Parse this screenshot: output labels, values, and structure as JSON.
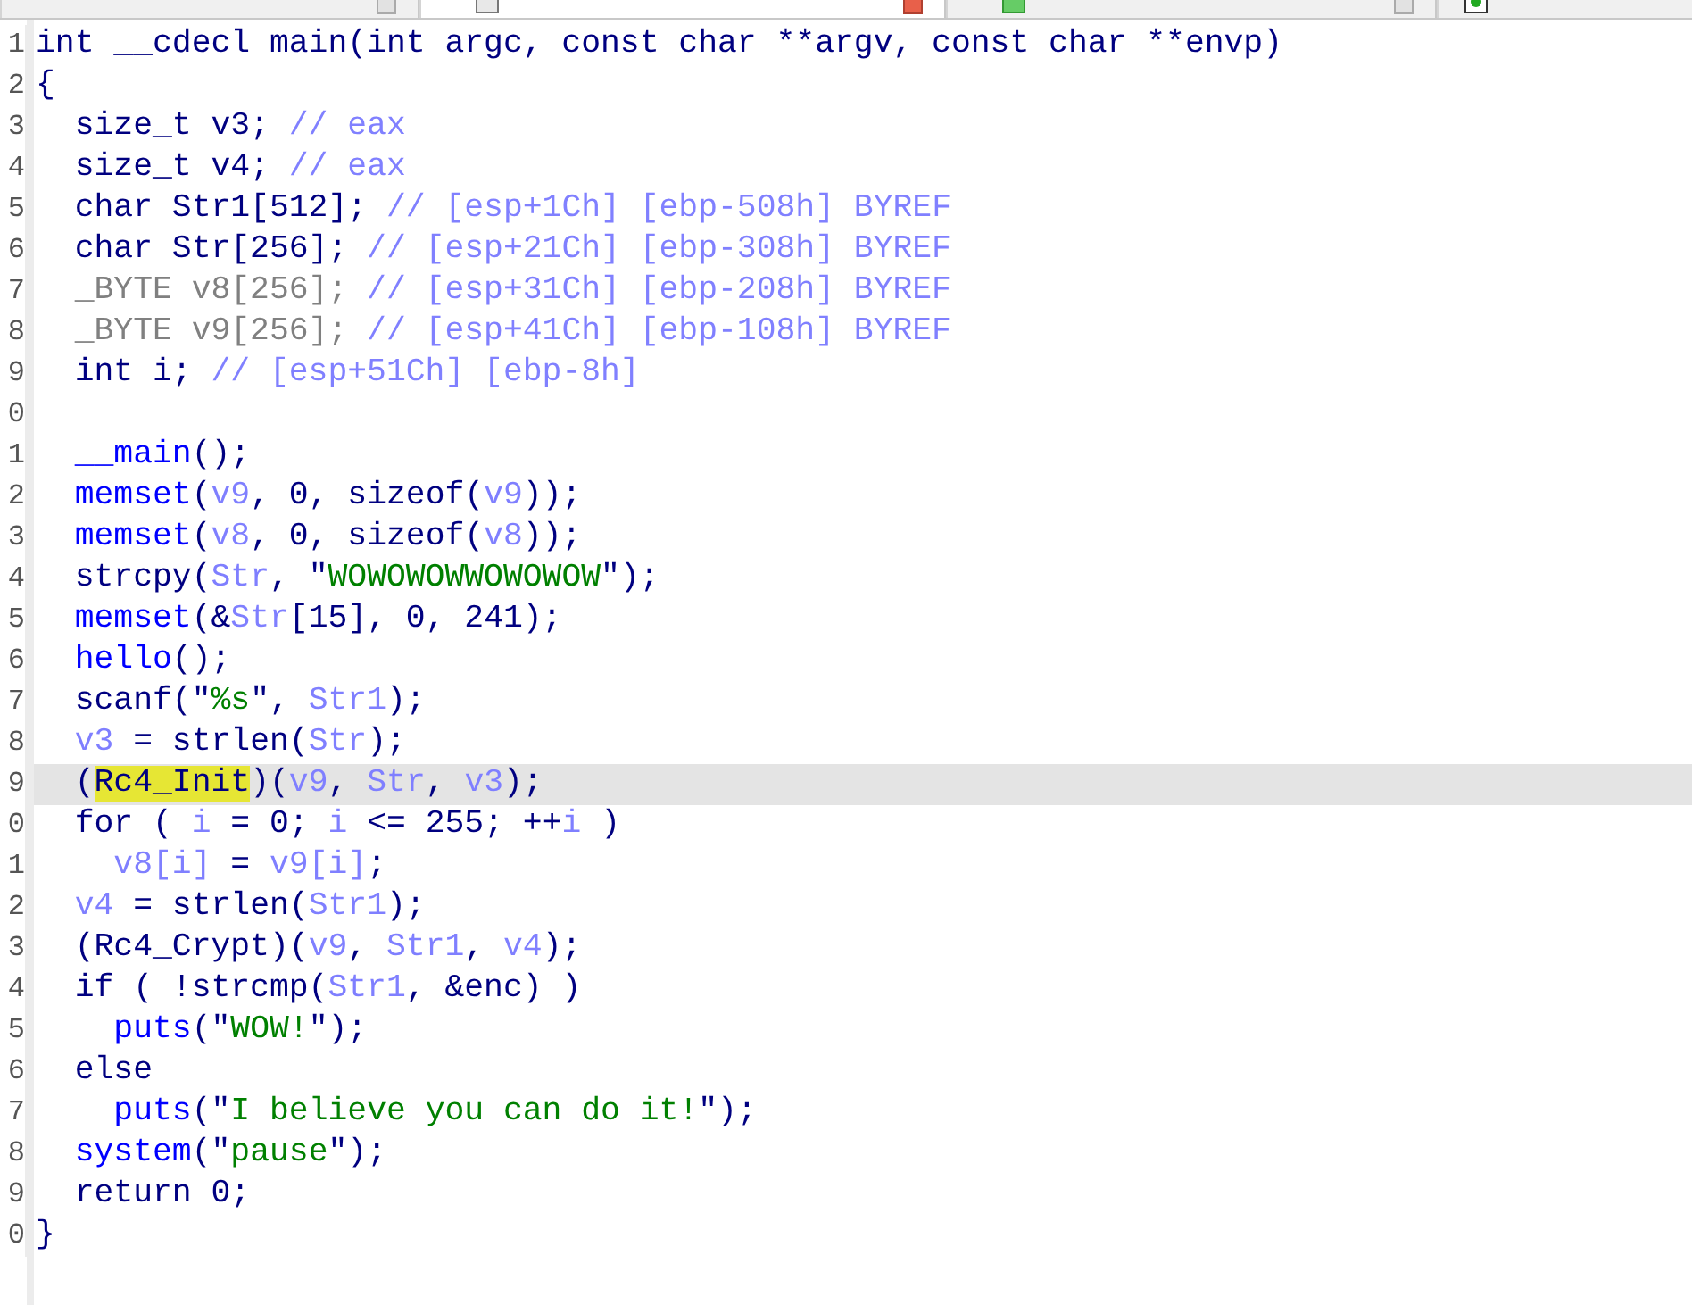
{
  "tabs": [
    {
      "kind": "disasm",
      "selected": false
    },
    {
      "kind": "pseudocode",
      "selected": true
    },
    {
      "kind": "strings",
      "selected": false
    },
    {
      "kind": "hex",
      "selected": false
    }
  ],
  "code": {
    "lines": [
      {
        "number": "1",
        "selected": false,
        "tokens": [
          {
            "kind": "plain",
            "text": "int __cdecl main(int argc, const char **argv, const char **envp)"
          }
        ]
      },
      {
        "number": "2",
        "selected": false,
        "tokens": [
          {
            "kind": "plain",
            "text": "{"
          }
        ]
      },
      {
        "number": "3",
        "selected": false,
        "tokens": [
          {
            "kind": "plain",
            "text": "  size_t v3; "
          },
          {
            "kind": "comment",
            "text": "// eax"
          }
        ]
      },
      {
        "number": "4",
        "selected": false,
        "tokens": [
          {
            "kind": "plain",
            "text": "  size_t v4; "
          },
          {
            "kind": "comment",
            "text": "// eax"
          }
        ]
      },
      {
        "number": "5",
        "selected": false,
        "tokens": [
          {
            "kind": "plain",
            "text": "  char Str1[512]; "
          },
          {
            "kind": "comment",
            "text": "// [esp+1Ch] [ebp-508h] BYREF"
          }
        ]
      },
      {
        "number": "6",
        "selected": false,
        "tokens": [
          {
            "kind": "plain",
            "text": "  char Str[256]; "
          },
          {
            "kind": "comment",
            "text": "// [esp+21Ch] [ebp-308h] BYREF"
          }
        ]
      },
      {
        "number": "7",
        "selected": false,
        "tokens": [
          {
            "kind": "dim",
            "text": "  _BYTE v8[256]; "
          },
          {
            "kind": "comment",
            "text": "// [esp+31Ch] [ebp-208h] BYREF"
          }
        ]
      },
      {
        "number": "8",
        "selected": false,
        "tokens": [
          {
            "kind": "dim",
            "text": "  _BYTE v9[256]; "
          },
          {
            "kind": "comment",
            "text": "// [esp+41Ch] [ebp-108h] BYREF"
          }
        ]
      },
      {
        "number": "9",
        "selected": false,
        "tokens": [
          {
            "kind": "plain",
            "text": "  int i; "
          },
          {
            "kind": "comment",
            "text": "// [esp+51Ch] [ebp-8h]"
          }
        ]
      },
      {
        "number": "0",
        "selected": false
      },
      {
        "number": "1",
        "selected": false,
        "tokens": [
          {
            "kind": "func",
            "text": "  __main"
          },
          {
            "kind": "plain",
            "text": "();"
          }
        ]
      },
      {
        "number": "2",
        "selected": false,
        "tokens": [
          {
            "kind": "func",
            "text": "  memset"
          },
          {
            "kind": "plain",
            "text": "("
          },
          {
            "kind": "var",
            "text": "v9"
          },
          {
            "kind": "plain",
            "text": ", 0, sizeof("
          },
          {
            "kind": "var",
            "text": "v9"
          },
          {
            "kind": "plain",
            "text": "));"
          }
        ]
      },
      {
        "number": "3",
        "selected": false,
        "tokens": [
          {
            "kind": "func",
            "text": "  memset"
          },
          {
            "kind": "plain",
            "text": "("
          },
          {
            "kind": "var",
            "text": "v8"
          },
          {
            "kind": "plain",
            "text": ", 0, sizeof("
          },
          {
            "kind": "var",
            "text": "v8"
          },
          {
            "kind": "plain",
            "text": "));"
          }
        ]
      },
      {
        "number": "4",
        "selected": false,
        "tokens": [
          {
            "kind": "plain",
            "text": "  strcpy("
          },
          {
            "kind": "var",
            "text": "Str"
          },
          {
            "kind": "plain",
            "text": ", \""
          },
          {
            "kind": "string",
            "text": "WOWOWOWWOWOWOW"
          },
          {
            "kind": "plain",
            "text": "\");"
          }
        ]
      },
      {
        "number": "5",
        "selected": false,
        "tokens": [
          {
            "kind": "func",
            "text": "  memset"
          },
          {
            "kind": "plain",
            "text": "(&"
          },
          {
            "kind": "var",
            "text": "Str"
          },
          {
            "kind": "plain",
            "text": "[15], 0, 241);"
          }
        ]
      },
      {
        "number": "6",
        "selected": false,
        "tokens": [
          {
            "kind": "func",
            "text": "  hello"
          },
          {
            "kind": "plain",
            "text": "();"
          }
        ]
      },
      {
        "number": "7",
        "selected": false,
        "tokens": [
          {
            "kind": "plain",
            "text": "  scanf(\""
          },
          {
            "kind": "string",
            "text": "%s"
          },
          {
            "kind": "plain",
            "text": "\", "
          },
          {
            "kind": "var",
            "text": "Str1"
          },
          {
            "kind": "plain",
            "text": ");"
          }
        ]
      },
      {
        "number": "8",
        "selected": false,
        "tokens": [
          {
            "kind": "var",
            "text": "  v3"
          },
          {
            "kind": "plain",
            "text": " = strlen("
          },
          {
            "kind": "var",
            "text": "Str"
          },
          {
            "kind": "plain",
            "text": ");"
          }
        ]
      },
      {
        "number": "9",
        "selected": true,
        "tokens": [
          {
            "kind": "plain",
            "text": "  ("
          },
          {
            "kind": "mark",
            "text": "Rc4_Init"
          },
          {
            "kind": "plain",
            "text": ")("
          },
          {
            "kind": "var",
            "text": "v9"
          },
          {
            "kind": "plain",
            "text": ", "
          },
          {
            "kind": "var",
            "text": "Str"
          },
          {
            "kind": "plain",
            "text": ", "
          },
          {
            "kind": "var",
            "text": "v3"
          },
          {
            "kind": "plain",
            "text": ");"
          }
        ]
      },
      {
        "number": "0",
        "selected": false,
        "tokens": [
          {
            "kind": "plain",
            "text": "  for ( "
          },
          {
            "kind": "var",
            "text": "i"
          },
          {
            "kind": "plain",
            "text": " = 0; "
          },
          {
            "kind": "var",
            "text": "i"
          },
          {
            "kind": "plain",
            "text": " <= 255; ++"
          },
          {
            "kind": "var",
            "text": "i"
          },
          {
            "kind": "plain",
            "text": " )"
          }
        ]
      },
      {
        "number": "1",
        "selected": false,
        "tokens": [
          {
            "kind": "var",
            "text": "    v8[i]"
          },
          {
            "kind": "plain",
            "text": " = "
          },
          {
            "kind": "var",
            "text": "v9[i]"
          },
          {
            "kind": "plain",
            "text": ";"
          }
        ]
      },
      {
        "number": "2",
        "selected": false,
        "tokens": [
          {
            "kind": "var",
            "text": "  v4"
          },
          {
            "kind": "plain",
            "text": " = strlen("
          },
          {
            "kind": "var",
            "text": "Str1"
          },
          {
            "kind": "plain",
            "text": ");"
          }
        ]
      },
      {
        "number": "3",
        "selected": false,
        "tokens": [
          {
            "kind": "plain",
            "text": "  (Rc4_Crypt)("
          },
          {
            "kind": "var",
            "text": "v9"
          },
          {
            "kind": "plain",
            "text": ", "
          },
          {
            "kind": "var",
            "text": "Str1"
          },
          {
            "kind": "plain",
            "text": ", "
          },
          {
            "kind": "var",
            "text": "v4"
          },
          {
            "kind": "plain",
            "text": ");"
          }
        ]
      },
      {
        "number": "4",
        "selected": false,
        "tokens": [
          {
            "kind": "plain",
            "text": "  if ( !strcmp("
          },
          {
            "kind": "var",
            "text": "Str1"
          },
          {
            "kind": "plain",
            "text": ", &enc) )"
          }
        ]
      },
      {
        "number": "5",
        "selected": false,
        "tokens": [
          {
            "kind": "func",
            "text": "    puts"
          },
          {
            "kind": "plain",
            "text": "(\""
          },
          {
            "kind": "string",
            "text": "WOW!"
          },
          {
            "kind": "plain",
            "text": "\");"
          }
        ]
      },
      {
        "number": "6",
        "selected": false,
        "tokens": [
          {
            "kind": "plain",
            "text": "  else"
          }
        ]
      },
      {
        "number": "7",
        "selected": false,
        "tokens": [
          {
            "kind": "func",
            "text": "    puts"
          },
          {
            "kind": "plain",
            "text": "(\""
          },
          {
            "kind": "string",
            "text": "I believe you can do it!"
          },
          {
            "kind": "plain",
            "text": "\");"
          }
        ]
      },
      {
        "number": "8",
        "selected": false,
        "tokens": [
          {
            "kind": "func",
            "text": "  system"
          },
          {
            "kind": "plain",
            "text": "(\""
          },
          {
            "kind": "string",
            "text": "pause"
          },
          {
            "kind": "plain",
            "text": "\");"
          }
        ]
      },
      {
        "number": "9",
        "selected": false,
        "tokens": [
          {
            "kind": "plain",
            "text": "  return 0;"
          }
        ]
      },
      {
        "number": "0",
        "selected": false,
        "tokens": [
          {
            "kind": "plain",
            "text": "}"
          }
        ]
      }
    ]
  }
}
